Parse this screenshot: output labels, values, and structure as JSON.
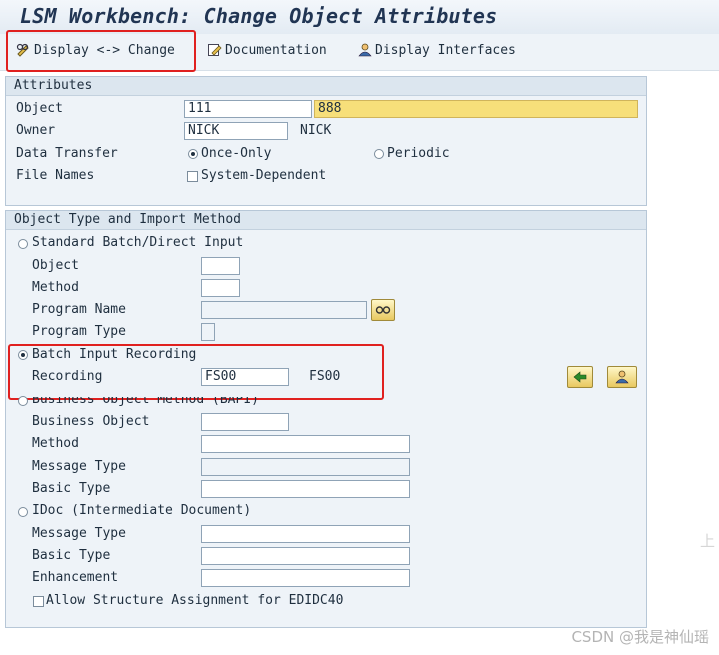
{
  "window": {
    "title": "LSM Workbench: Change Object Attributes"
  },
  "toolbar": {
    "display_change": "Display <-> Change",
    "documentation": "Documentation",
    "display_interfaces": "Display Interfaces"
  },
  "attributes": {
    "heading": "Attributes",
    "object_label": "Object",
    "object_value": "111",
    "object_desc": "888",
    "owner_label": "Owner",
    "owner_value": "NICK",
    "owner_name": "NICK",
    "data_transfer_label": "Data Transfer",
    "once_only": "Once-Only",
    "periodic": "Periodic",
    "file_names_label": "File Names",
    "system_dependent": "System-Dependent"
  },
  "method": {
    "heading": "Object Type and Import Method",
    "standard": {
      "label": "Standard Batch/Direct Input",
      "object_label": "Object",
      "object_value": "",
      "method_label": "Method",
      "method_value": "",
      "program_name_label": "Program Name",
      "program_name_value": "",
      "program_type_label": "Program Type",
      "program_type_value": ""
    },
    "batch": {
      "label": "Batch Input Recording",
      "recording_label": "Recording",
      "recording_value": "FS00",
      "recording_desc": "FS00"
    },
    "bapi": {
      "label": "Business Object Method  (BAPI)",
      "business_object_label": "Business Object",
      "business_object_value": "",
      "method_label": "Method",
      "method_value": "",
      "message_type_label": "Message Type",
      "message_type_value": "",
      "basic_type_label": "Basic Type",
      "basic_type_value": ""
    },
    "idoc": {
      "label": "IDoc (Intermediate Document)",
      "message_type_label": "Message Type",
      "message_type_value": "",
      "basic_type_label": "Basic Type",
      "basic_type_value": "",
      "enhancement_label": "Enhancement",
      "enhancement_value": "",
      "allow_structure": "Allow Structure Assignment for EDIDC40"
    }
  },
  "watermark": "CSDN @我是神仙瑶",
  "side_char": "上"
}
